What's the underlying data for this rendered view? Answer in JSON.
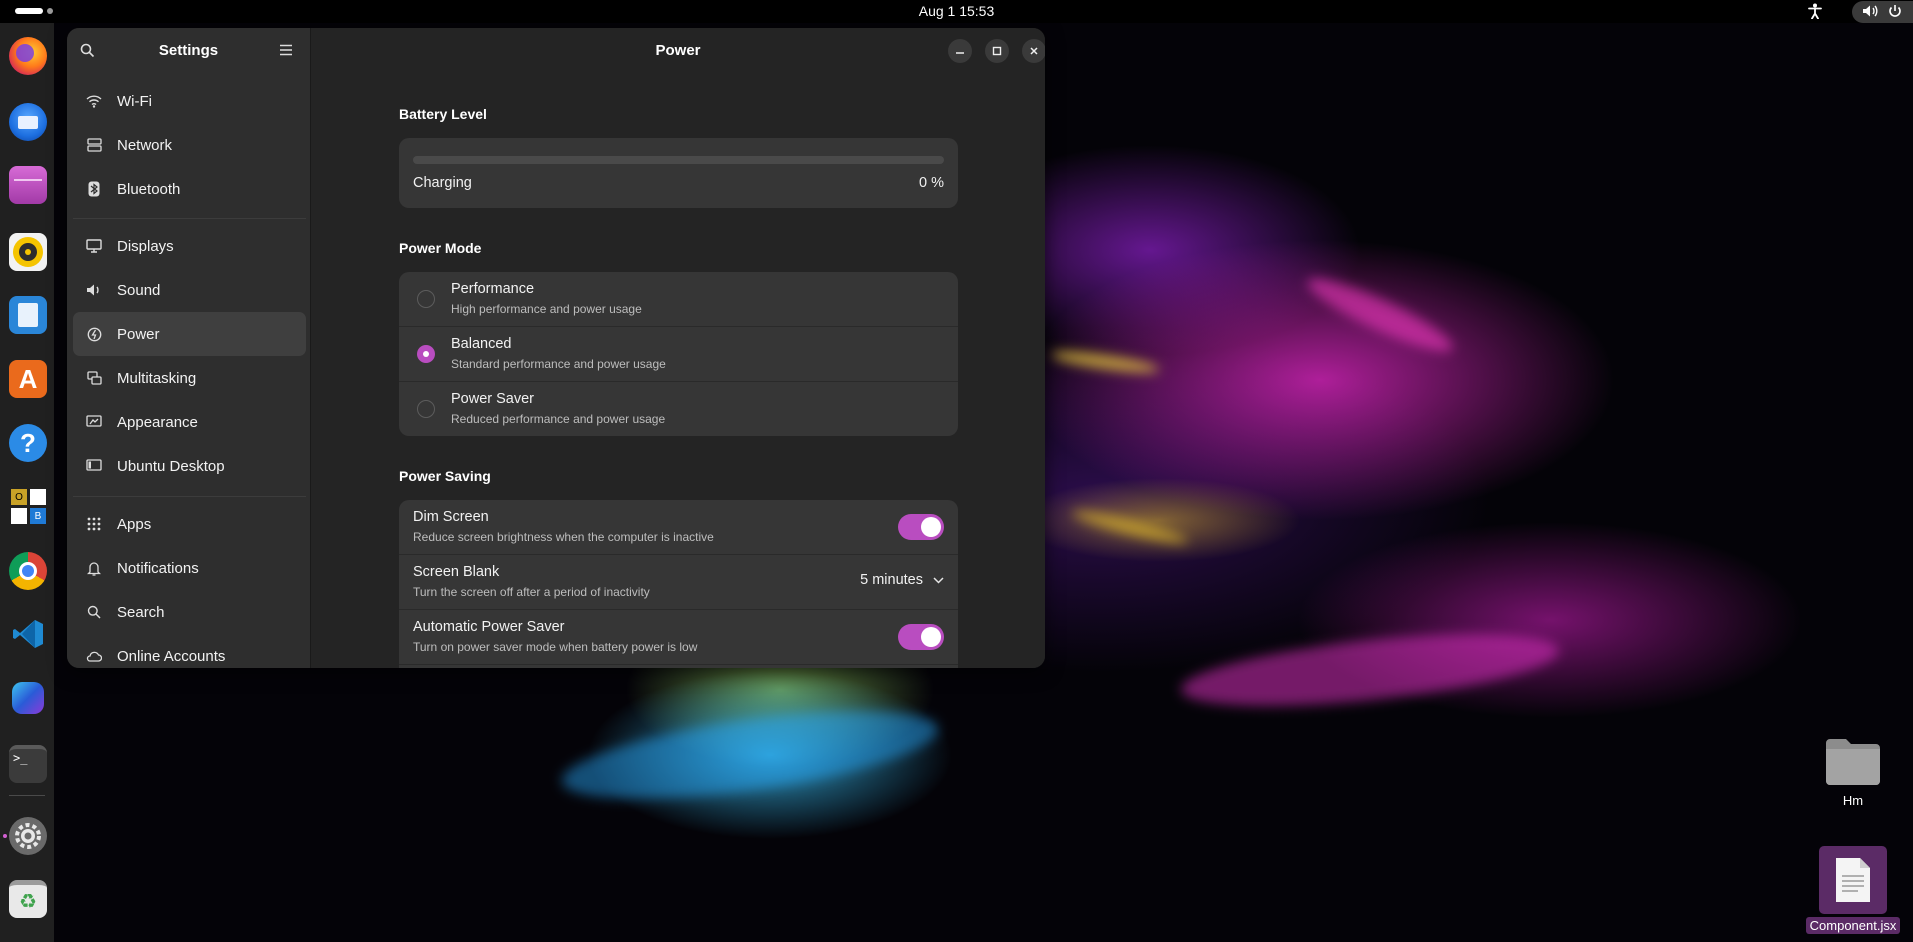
{
  "topbar": {
    "clock": "Aug 1  15:53",
    "icons": [
      "activities-indicator",
      "accessibility-icon",
      "volume-icon",
      "power-icon"
    ]
  },
  "dock": {
    "apps": [
      "firefox",
      "thunderbird",
      "files",
      "rhythmbox",
      "libreoffice-writer",
      "app-center",
      "help",
      "libreoffice-apps",
      "chrome",
      "vscode",
      "copilot",
      "terminal",
      "settings",
      "trash"
    ],
    "terminal_glyph": ">_",
    "office_letters": [
      "O",
      "B"
    ]
  },
  "sidebar": {
    "title": "Settings",
    "items": [
      {
        "label": "Wi-Fi",
        "icon": "wifi-icon"
      },
      {
        "label": "Network",
        "icon": "network-icon"
      },
      {
        "label": "Bluetooth",
        "icon": "bluetooth-icon"
      },
      {
        "label": "Displays",
        "icon": "display-icon"
      },
      {
        "label": "Sound",
        "icon": "sound-icon"
      },
      {
        "label": "Power",
        "icon": "power-icon",
        "selected": true
      },
      {
        "label": "Multitasking",
        "icon": "multitasking-icon"
      },
      {
        "label": "Appearance",
        "icon": "appearance-icon"
      },
      {
        "label": "Ubuntu Desktop",
        "icon": "ubuntu-desktop-icon"
      },
      {
        "label": "Apps",
        "icon": "apps-icon"
      },
      {
        "label": "Notifications",
        "icon": "bell-icon"
      },
      {
        "label": "Search",
        "icon": "search-icon"
      },
      {
        "label": "Online Accounts",
        "icon": "cloud-icon"
      }
    ]
  },
  "content": {
    "title": "Power",
    "battery": {
      "heading": "Battery Level",
      "status": "Charging",
      "percent_label": "0 %",
      "level": 0
    },
    "power_mode": {
      "heading": "Power Mode",
      "options": [
        {
          "title": "Performance",
          "subtitle": "High performance and power usage",
          "selected": false
        },
        {
          "title": "Balanced",
          "subtitle": "Standard performance and power usage",
          "selected": true
        },
        {
          "title": "Power Saver",
          "subtitle": "Reduced performance and power usage",
          "selected": false
        }
      ]
    },
    "power_saving": {
      "heading": "Power Saving",
      "dim_screen": {
        "title": "Dim Screen",
        "subtitle": "Reduce screen brightness when the computer is inactive",
        "enabled": true
      },
      "screen_blank": {
        "title": "Screen Blank",
        "subtitle": "Turn the screen off after a period of inactivity",
        "value": "5 minutes"
      },
      "auto_power_saver": {
        "title": "Automatic Power Saver",
        "subtitle": "Turn on power saver mode when battery power is low",
        "enabled": true
      }
    }
  },
  "desktop": {
    "folder_label": "Hm",
    "file_label": "Component.jsx"
  },
  "colors": {
    "accent": "#b94dc0",
    "window_bg": "#242424",
    "sidebar_bg": "#2e2e2e",
    "card_bg": "#363636"
  }
}
